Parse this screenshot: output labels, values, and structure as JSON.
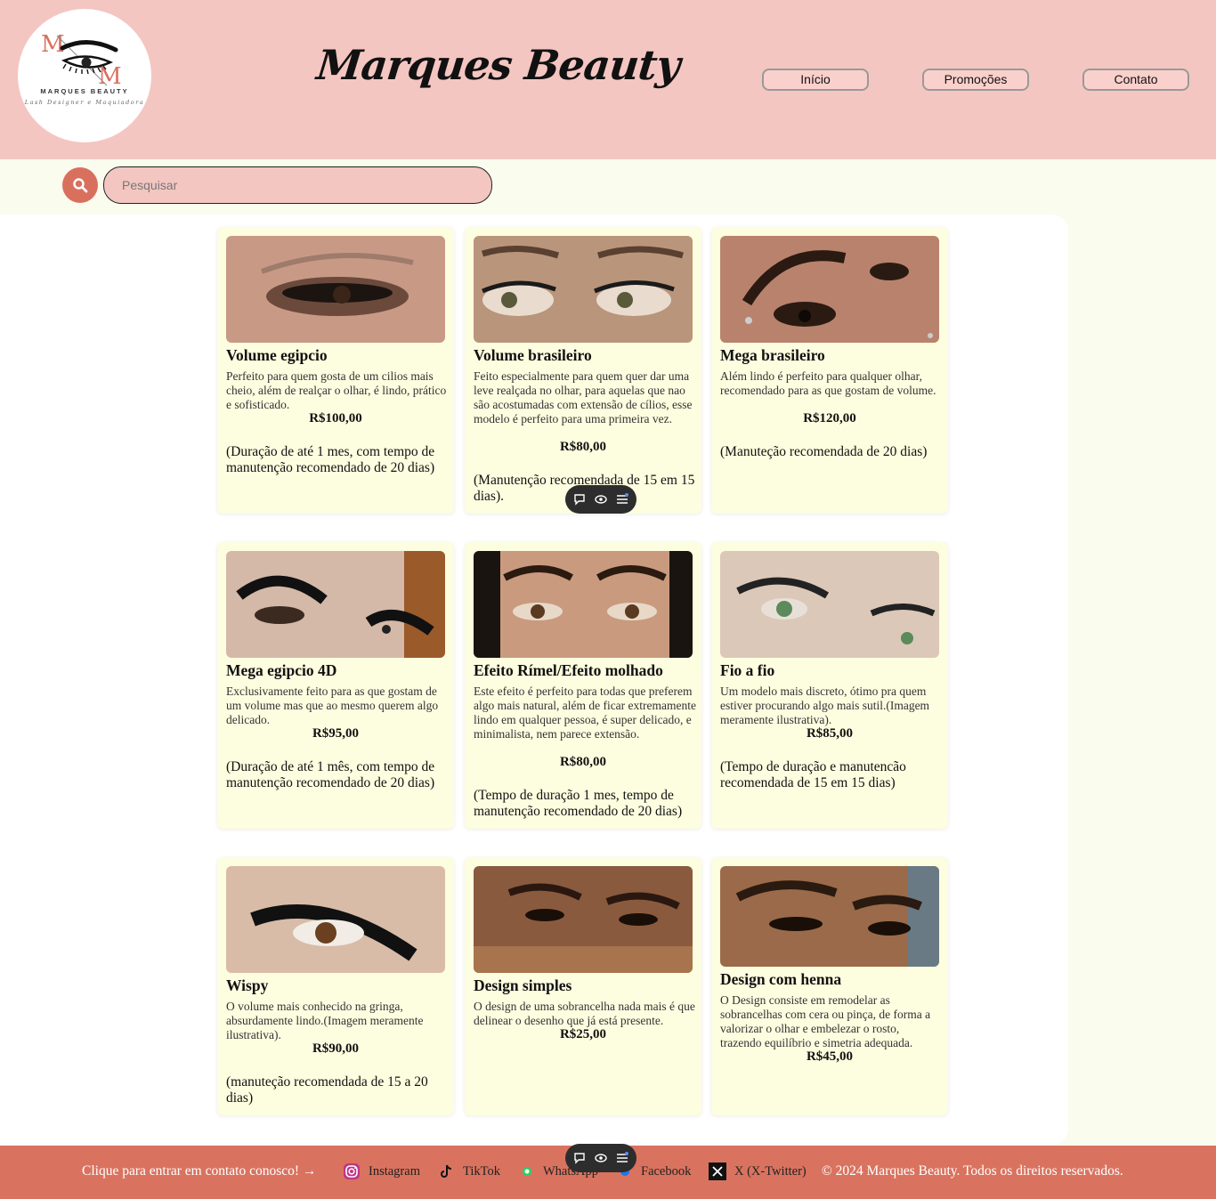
{
  "header": {
    "logo_initials": "M/M",
    "logo_name": "MARQUES BEAUTY",
    "logo_tagline": "Lash Designer e Maquiadora",
    "brand": "Marques Beauty",
    "nav": [
      {
        "label": "Início"
      },
      {
        "label": "Promoções"
      },
      {
        "label": "Contato"
      }
    ]
  },
  "search": {
    "placeholder": "Pesquisar",
    "icon": "search-icon"
  },
  "cards": [
    {
      "title": "Volume egipcio",
      "desc": "Perfeito para quem gosta de um cilios mais cheio, além de realçar o olhar, é lindo, prático e sofisticado.",
      "price": "R$100,00",
      "note": "(Duração de até 1 mes, com tempo de manutenção recomendado de 20 dias)"
    },
    {
      "title": "Volume brasileiro",
      "desc": "Feito especialmente para quem quer dar uma leve realçada no olhar, para aquelas que nao são acostumadas com extensão de cílios, esse modelo é perfeito para uma primeira vez.",
      "price": "R$80,00",
      "note": "(Manutenção recomendada de 15 em 15 dias)."
    },
    {
      "title": "Mega brasileiro",
      "desc": "Além lindo é perfeito para qualquer olhar, recomendado para as que gostam de volume.",
      "price": "R$120,00",
      "note": "(Manuteção recomendada de 20 dias)"
    },
    {
      "title": "Mega egipcio 4D",
      "desc": "Exclusivamente feito para as que gostam de um volume mas que ao mesmo querem algo delicado.",
      "price": "R$95,00",
      "note": "(Duração de até 1 mês, com tempo de manutenção recomendado de 20 dias)"
    },
    {
      "title": "Efeito Rímel/Efeito molhado",
      "desc": "Este efeito é perfeito para todas que preferem algo mais natural, além de ficar extremamente lindo em qualquer pessoa, é super delicado, e minimalista, nem parece extensão.",
      "price": "R$80,00",
      "note": "(Tempo de duração 1 mes, tempo de manutenção recomendado de 20 dias)"
    },
    {
      "title": "Fio a fio",
      "desc": "Um modelo mais discreto, ótimo pra quem estiver procurando algo mais sutil.(Imagem meramente ilustrativa).",
      "price": "R$85,00",
      "note": "(Tempo de duração e manutencão recomendada de 15 em 15 dias)"
    },
    {
      "title": "Wispy",
      "desc": "O volume mais conhecido na gringa, absurdamente lindo.(Imagem meramente ilustrativa).",
      "price": "R$90,00",
      "note": "(manuteção recomendada de 15 a 20 dias)"
    },
    {
      "title": "Design simples",
      "desc": "O design de uma sobrancelha nada mais é que delinear o desenho que já está presente.",
      "price": "R$25,00",
      "note": ""
    },
    {
      "title": "Design com henna",
      "desc": "O Design consiste em remodelar as sobrancelhas com cera ou pinça, de forma a valorizar o olhar e embelezar o rosto, trazendo equilíbrio e simetria adequada.",
      "price": "R$45,00",
      "note": ""
    }
  ],
  "footer": {
    "cta": "Clique para entrar em contato conosco! →",
    "links": [
      {
        "label": "Instagram",
        "icon": "instagram-icon"
      },
      {
        "label": "TikTok",
        "icon": "tiktok-icon"
      },
      {
        "label": "WhatsApp",
        "icon": "whatsapp-icon"
      },
      {
        "label": "Facebook",
        "icon": "facebook-icon"
      },
      {
        "label": "X (X-Twitter)",
        "icon": "x-twitter-icon"
      }
    ],
    "copyright": "© 2024 Marques Beauty. Todos os direitos reservados."
  },
  "colors": {
    "header_bg": "#f4c6c1",
    "page_bg": "#fafcee",
    "card_bg": "#fdfde0",
    "footer_bg": "#d9735f",
    "accent": "#d9705e"
  }
}
